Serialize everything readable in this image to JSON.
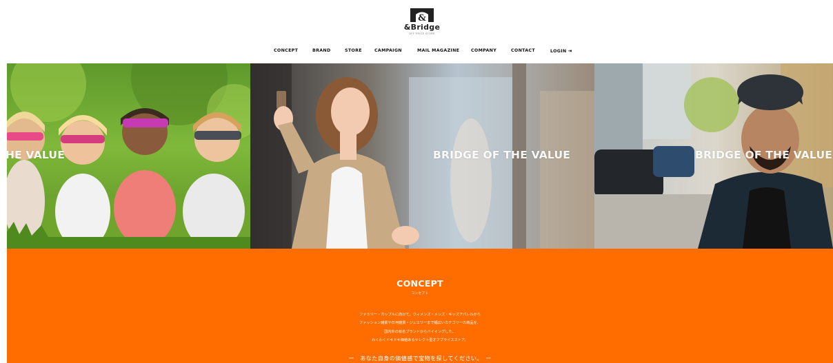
{
  "brand": {
    "name": "&Bridge",
    "sub": "OFF PRICE STORE"
  },
  "nav": {
    "items": [
      {
        "label": "CONCEPT"
      },
      {
        "label": "BRAND"
      },
      {
        "label": "STORE"
      },
      {
        "label": "CAMPAIGN"
      },
      {
        "label": "MAIL MAGAZINE"
      },
      {
        "label": "COMPANY"
      },
      {
        "label": "CONTACT"
      },
      {
        "label": "LOGIN"
      }
    ],
    "login_icon": "login-arrow-icon"
  },
  "hero": {
    "slides": [
      {
        "caption": "HE VALUE",
        "image": "kids-in-sunglasses-on-grass"
      },
      {
        "caption": "BRIDGE OF THE VALUE",
        "image": "woman-with-phone-in-trench-coat"
      },
      {
        "caption": "BRIDGE OF THE VALUE",
        "image": "man-in-beanie-on-street"
      }
    ]
  },
  "concept": {
    "title": "CONCEPT",
    "subtitle": "コンセプト",
    "lines": [
      "ファミリー・カップルに向けて、ウィメンズ・メンズ・キッズアパレルから",
      "ファッション雑貨や日用雑貨・ジュエリーまで幅広いカテゴリーの商品を、",
      "国内外の有名ブランドからバイイングした、",
      "わくわくドキドキ価値あるセレクト型オフプライスストア。"
    ],
    "tagline": "ー　あなた自身の価値感で宝物を探してください。　ー"
  },
  "colors": {
    "accent": "#ff6d00",
    "text": "#111111",
    "background": "#ffffff"
  }
}
